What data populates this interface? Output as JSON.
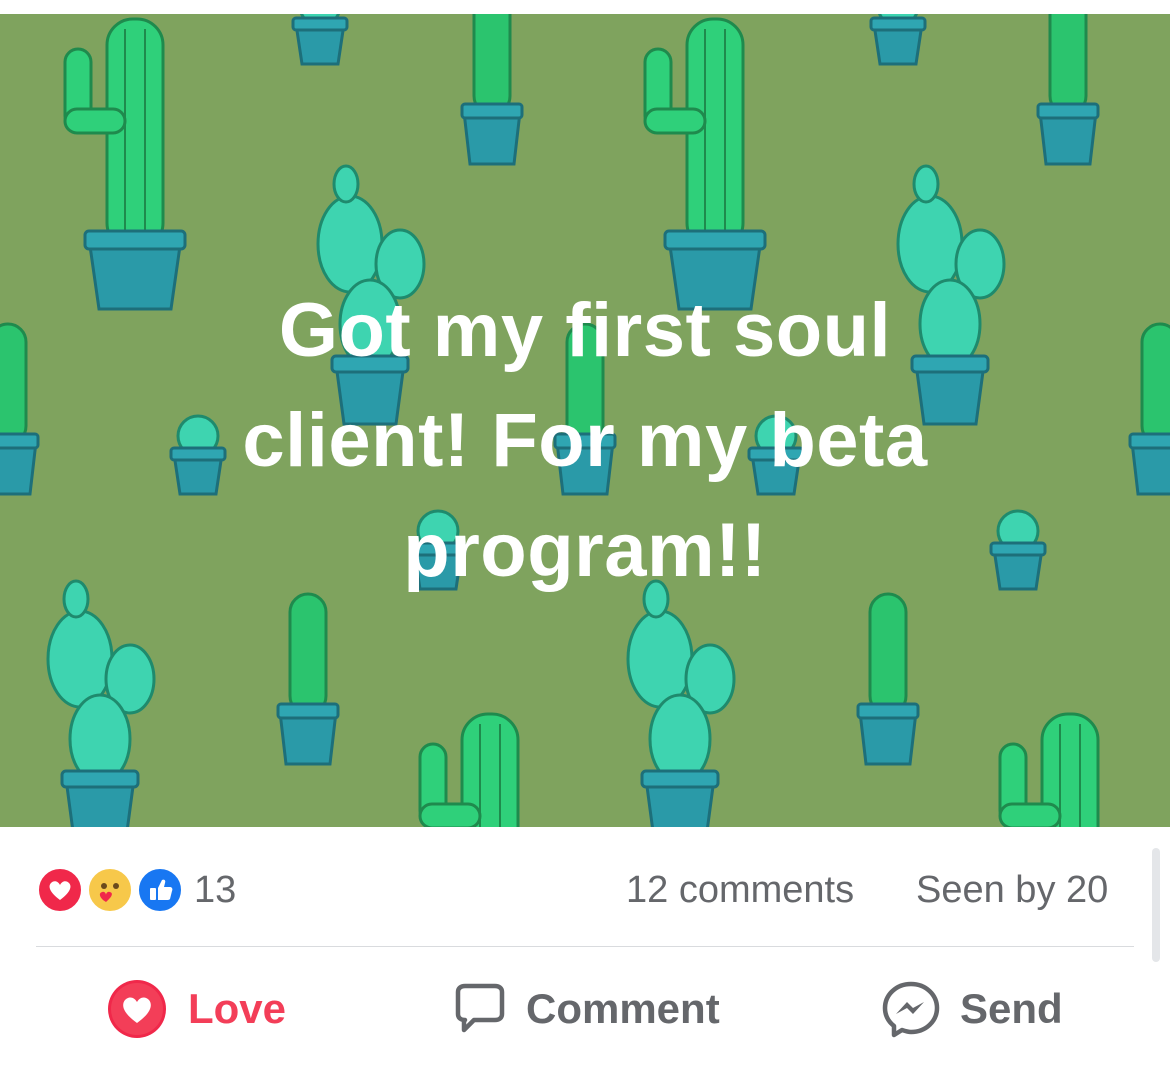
{
  "post": {
    "text_lines": [
      "Got my first soul",
      "client! For my beta",
      "program!!"
    ],
    "background_color": "#7fa35e"
  },
  "reactions": {
    "types": [
      "love-icon",
      "care-icon",
      "like-icon"
    ],
    "count": "13"
  },
  "stats": {
    "comments": "12 comments",
    "seen_by": "Seen by 20"
  },
  "actions": {
    "love_label": "Love",
    "comment_label": "Comment",
    "send_label": "Send"
  },
  "colors": {
    "love": "#f33e58",
    "like": "#1877f2",
    "muted": "#65676b"
  }
}
